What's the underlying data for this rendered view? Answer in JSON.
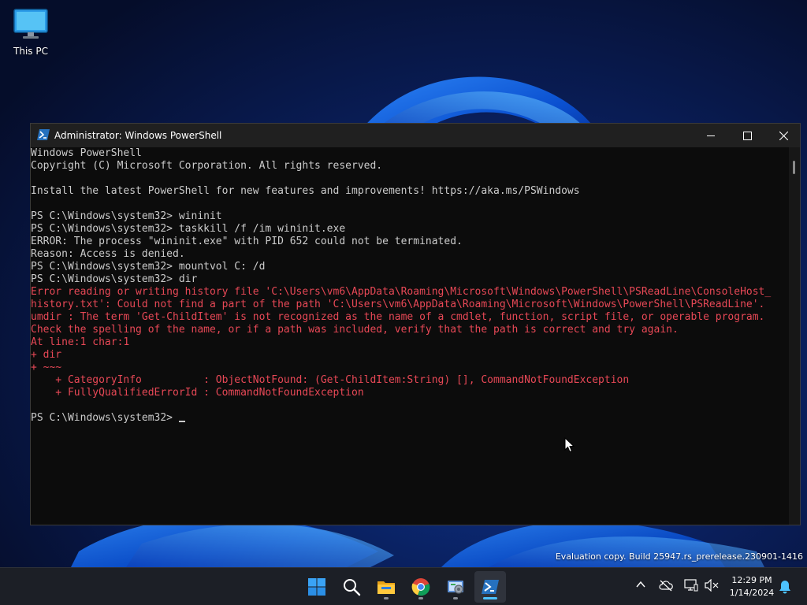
{
  "desktop": {
    "icons": [
      {
        "label": "This PC",
        "icon": "monitor-icon"
      }
    ],
    "watermark": "Evaluation copy. Build 25947.rs_prerelease.230901-1416"
  },
  "window": {
    "title": "Administrator: Windows PowerShell",
    "icon": "powershell-icon",
    "controls": {
      "minimize": "minimize-icon",
      "maximize": "maximize-icon",
      "close": "close-icon"
    },
    "colors": {
      "background": "#0c0c0c",
      "text": "#cccccc",
      "error": "#e74856",
      "titlebar": "#202020"
    }
  },
  "console": {
    "lines": [
      {
        "text": "Windows PowerShell",
        "error": false
      },
      {
        "text": "Copyright (C) Microsoft Corporation. All rights reserved.",
        "error": false
      },
      {
        "text": "",
        "error": false
      },
      {
        "text": "Install the latest PowerShell for new features and improvements! https://aka.ms/PSWindows",
        "error": false
      },
      {
        "text": "",
        "error": false
      },
      {
        "text": "PS C:\\Windows\\system32> wininit",
        "error": false
      },
      {
        "text": "PS C:\\Windows\\system32> taskkill /f /im wininit.exe",
        "error": false
      },
      {
        "text": "ERROR: The process \"wininit.exe\" with PID 652 could not be terminated.",
        "error": false
      },
      {
        "text": "Reason: Access is denied.",
        "error": false
      },
      {
        "text": "PS C:\\Windows\\system32> mountvol C: /d",
        "error": false
      },
      {
        "text": "PS C:\\Windows\\system32> dir",
        "error": false
      },
      {
        "text": "Error reading or writing history file 'C:\\Users\\vm6\\AppData\\Roaming\\Microsoft\\Windows\\PowerShell\\PSReadLine\\ConsoleHost_",
        "error": true
      },
      {
        "text": "history.txt': Could not find a part of the path 'C:\\Users\\vm6\\AppData\\Roaming\\Microsoft\\Windows\\PowerShell\\PSReadLine'.",
        "error": true
      },
      {
        "text": "umdir : The term 'Get-ChildItem' is not recognized as the name of a cmdlet, function, script file, or operable program.",
        "error": true
      },
      {
        "text": "Check the spelling of the name, or if a path was included, verify that the path is correct and try again.",
        "error": true
      },
      {
        "text": "At line:1 char:1",
        "error": true
      },
      {
        "text": "+ dir",
        "error": true
      },
      {
        "text": "+ ~~~",
        "error": true
      },
      {
        "text": "    + CategoryInfo          : ObjectNotFound: (Get-ChildItem:String) [], CommandNotFoundException",
        "error": true
      },
      {
        "text": "    + FullyQualifiedErrorId : CommandNotFoundException",
        "error": true
      },
      {
        "text": "",
        "error": false
      }
    ],
    "prompt": "PS C:\\Windows\\system32> "
  },
  "taskbar": {
    "apps": [
      {
        "name": "start",
        "icon": "windows-start-icon",
        "active": false
      },
      {
        "name": "search",
        "icon": "search-icon",
        "active": false
      },
      {
        "name": "file-explorer",
        "icon": "folder-icon",
        "active": false,
        "running": true
      },
      {
        "name": "chrome",
        "icon": "chrome-icon",
        "active": false,
        "running": true
      },
      {
        "name": "control-panel",
        "icon": "control-panel-icon",
        "active": false,
        "running": true
      },
      {
        "name": "powershell",
        "icon": "powershell-icon",
        "active": true,
        "running": true
      }
    ],
    "tray": [
      "chevron-up-icon",
      "cloud-offline-icon",
      "network-icon",
      "volume-muted-icon"
    ],
    "clock": {
      "time": "12:29 PM",
      "date": "1/14/2024"
    },
    "notification_icon": "bell-icon"
  }
}
